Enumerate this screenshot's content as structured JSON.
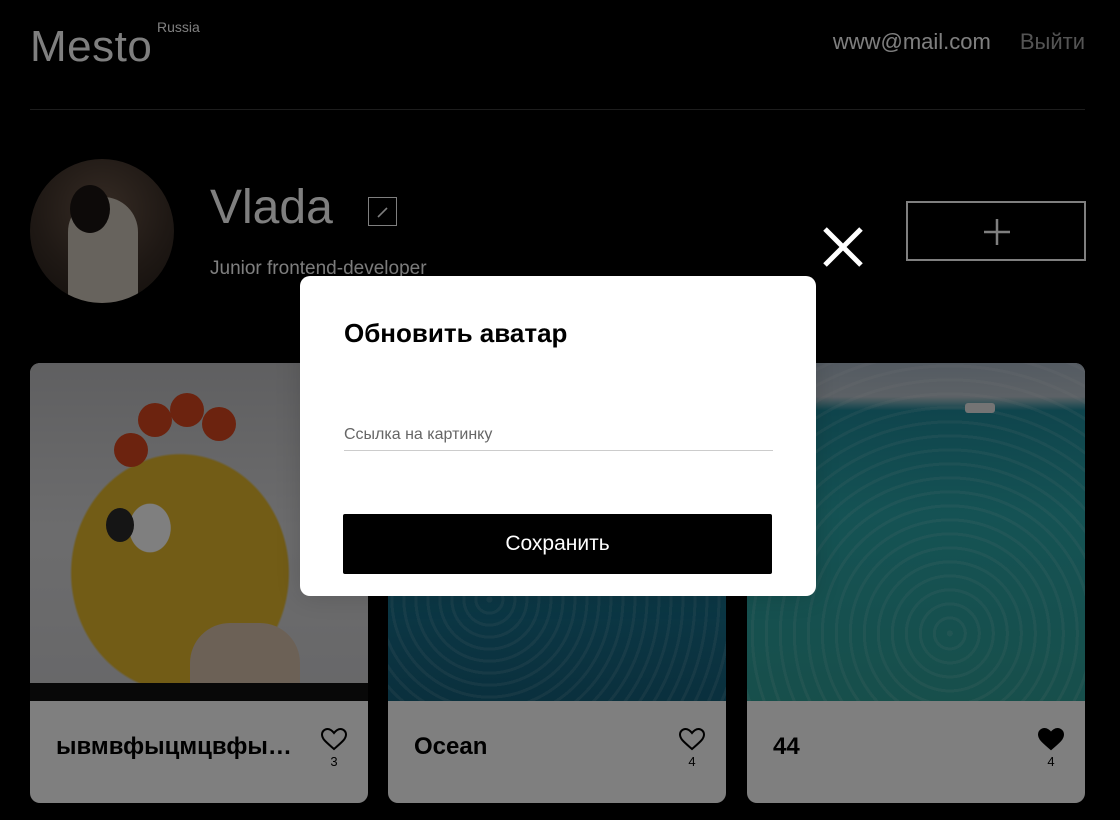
{
  "header": {
    "logo": "Mesto",
    "region": "Russia",
    "email": "www@mail.com",
    "logout": "Выйти"
  },
  "profile": {
    "name": "Vlada",
    "about": "Junior frontend-developer"
  },
  "cards": [
    {
      "title": "ывмвфыцмцвфыцмцвф",
      "likes": "3",
      "liked": false
    },
    {
      "title": "Ocean",
      "likes": "4",
      "liked": false
    },
    {
      "title": "44",
      "likes": "4",
      "liked": true
    }
  ],
  "popup": {
    "title": "Обновить аватар",
    "input_placeholder": "Ссылка на картинку",
    "submit_label": "Сохранить"
  },
  "icons": {
    "close": "close-icon",
    "edit": "pencil-icon",
    "add": "plus-icon",
    "like": "heart-icon"
  }
}
